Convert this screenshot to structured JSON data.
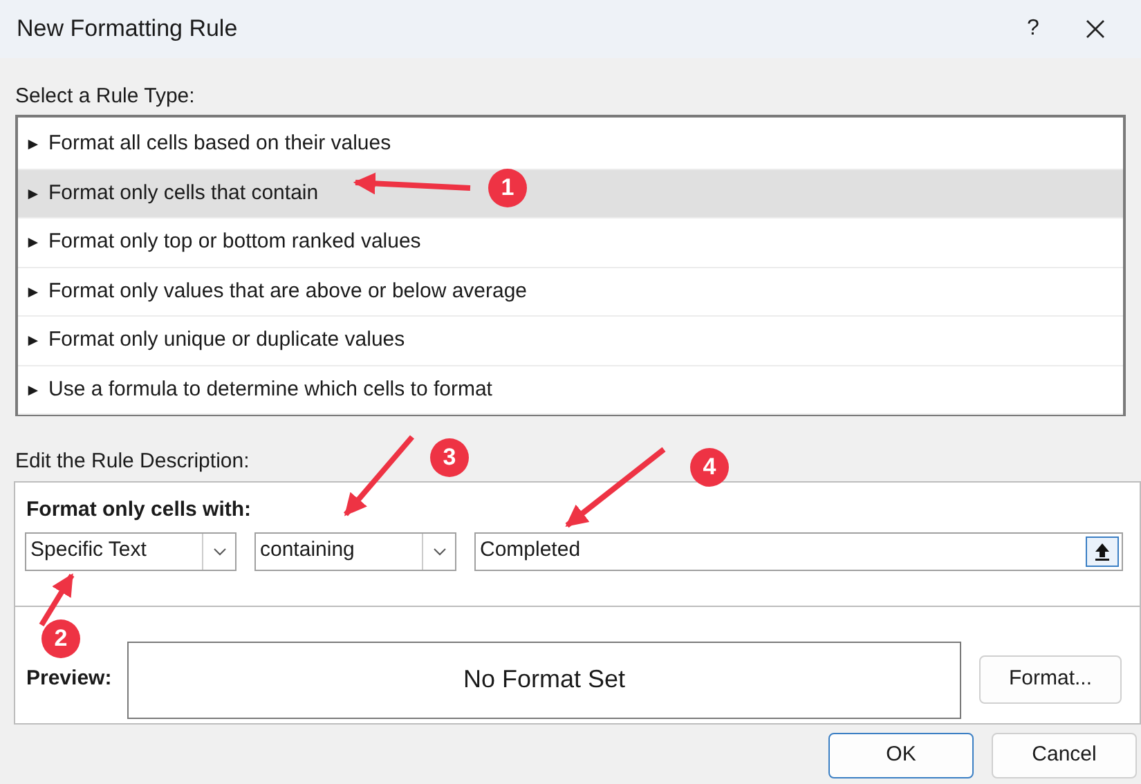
{
  "window": {
    "title": "New Formatting Rule",
    "help": "?"
  },
  "rule_type": {
    "label": "Select a Rule Type:",
    "items": [
      {
        "marker": "►",
        "label": "Format all cells based on their values",
        "selected": false
      },
      {
        "marker": "►",
        "label": "Format only cells that contain",
        "selected": true
      },
      {
        "marker": "►",
        "label": "Format only top or bottom ranked values",
        "selected": false
      },
      {
        "marker": "►",
        "label": "Format only values that are above or below average",
        "selected": false
      },
      {
        "marker": "►",
        "label": "Format only unique or duplicate values",
        "selected": false
      },
      {
        "marker": "►",
        "label": "Use a formula to determine which cells to format",
        "selected": false
      }
    ]
  },
  "description": {
    "label": "Edit the Rule Description:",
    "heading": "Format only cells with:",
    "condition": {
      "value": "Specific Text"
    },
    "operator": {
      "value": "containing"
    },
    "text": {
      "value": "Completed"
    },
    "preview": {
      "label": "Preview:",
      "text": "No Format Set"
    },
    "format_button": "Format..."
  },
  "buttons": [
    "OK",
    "Cancel"
  ],
  "annotations": [
    {
      "label": "1"
    },
    {
      "label": "2"
    },
    {
      "label": "3"
    },
    {
      "label": "4"
    }
  ]
}
